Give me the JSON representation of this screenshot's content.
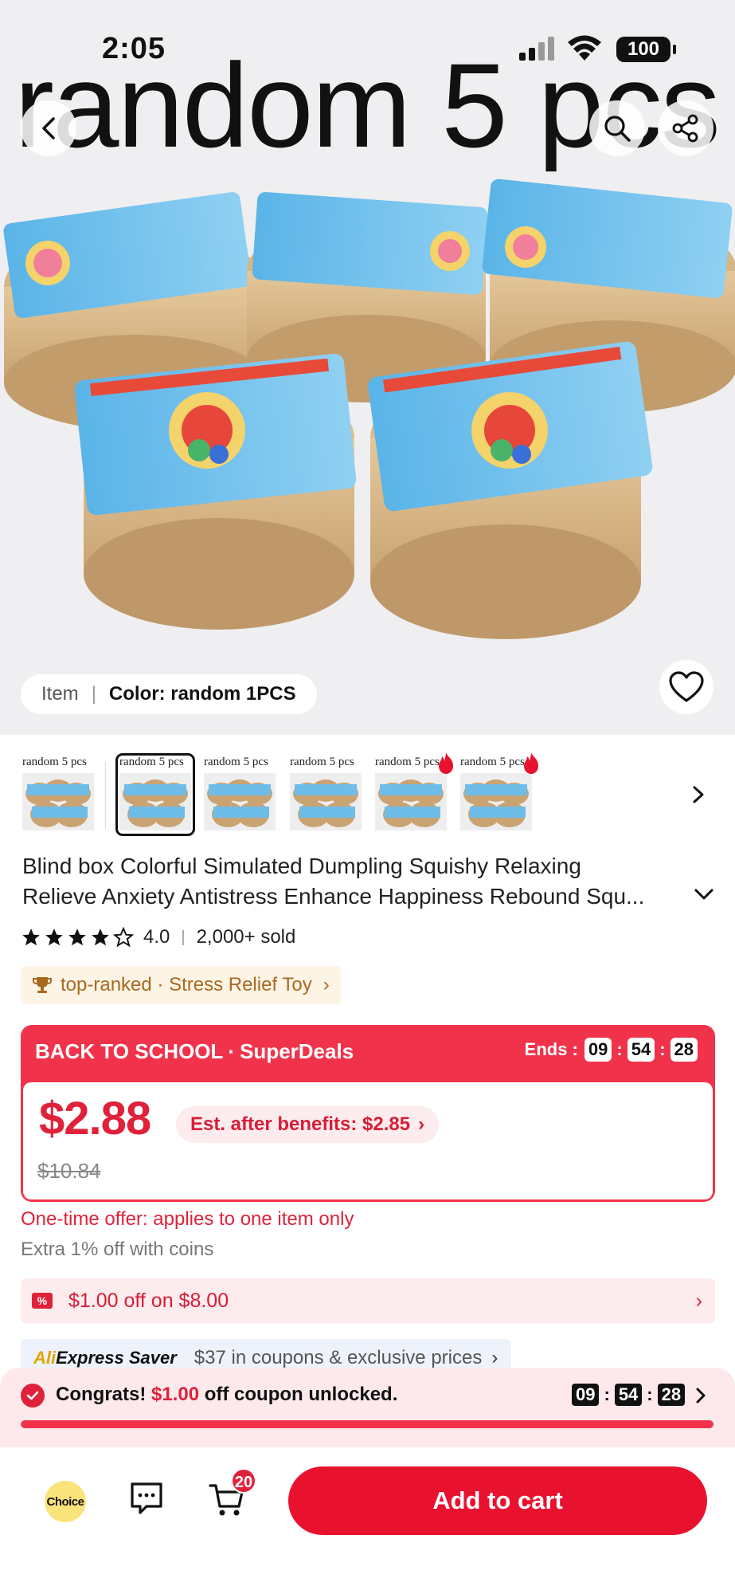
{
  "status_bar": {
    "time": "2:05",
    "battery": "100"
  },
  "hero": {
    "overlay_text": "random 5 pcs",
    "variant_label": "Item",
    "variant_value": "Color: random 1PCS"
  },
  "thumbnails": [
    {
      "caption": "random 5 pcs",
      "selected": false,
      "hot": false
    },
    {
      "caption": "random 5 pcs",
      "selected": true,
      "hot": false
    },
    {
      "caption": "random 5 pcs",
      "selected": false,
      "hot": false
    },
    {
      "caption": "random 5 pcs",
      "selected": false,
      "hot": false
    },
    {
      "caption": "random 5 pcs",
      "selected": false,
      "hot": true
    },
    {
      "caption": "random 5 pcs",
      "selected": false,
      "hot": true
    }
  ],
  "product": {
    "title_line1": "Blind box Colorful Simulated Dumpling Squishy Relaxing",
    "title_line2": "Relieve Anxiety Antistress Enhance Happiness Rebound Squ...",
    "rating": "4.0",
    "stars_filled": 4,
    "sold": "2,000+ sold",
    "rank_text": "top-ranked · Stress Relief Toy"
  },
  "deal": {
    "label": "BACK TO SCHOOL",
    "sublabel": "SuperDeals",
    "ends_label": "Ends :",
    "hours": "09",
    "minutes": "54",
    "seconds": "28",
    "price": "$2.88",
    "est_benefits": "Est. after benefits: $2.85",
    "original_price": "$10.84"
  },
  "offers": {
    "one_time": "One-time offer: applies to one item only",
    "coins": "Extra 1% off with coins",
    "coupon": "$1.00 off on $8.00",
    "saver_brand_prefix": "Ali",
    "saver_brand_rest": "Express Saver",
    "saver_text": "$37 in coupons & exclusive prices"
  },
  "congrats": {
    "prefix": "Congrats! ",
    "amount": "$1.00",
    "suffix": " off coupon unlocked.",
    "hours": "09",
    "minutes": "54",
    "seconds": "28",
    "progress": 1.0
  },
  "bottom_bar": {
    "choice_label": "Choice",
    "cart_count": "20",
    "add_to_cart": "Add to cart"
  },
  "colors": {
    "accent": "#e8122f",
    "deal_red": "#f0334b",
    "rank_gold": "#a86a1e"
  }
}
